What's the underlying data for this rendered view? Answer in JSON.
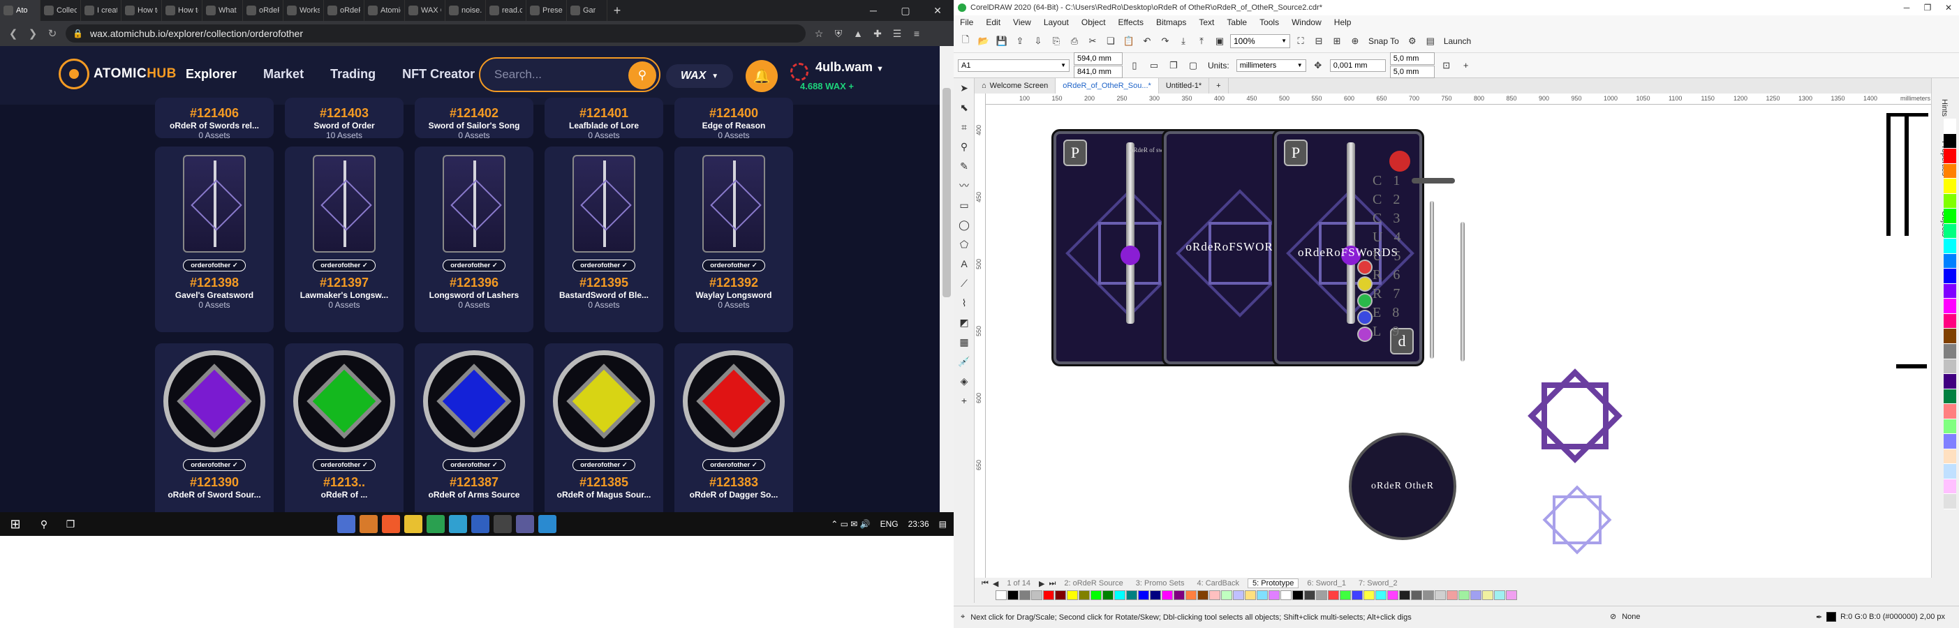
{
  "browser": {
    "tabs": [
      {
        "label": "Ato",
        "active": true
      },
      {
        "label": "Collecti"
      },
      {
        "label": "I create"
      },
      {
        "label": "How to"
      },
      {
        "label": "How to"
      },
      {
        "label": "What t"
      },
      {
        "label": "oRdeR"
      },
      {
        "label": "Works"
      },
      {
        "label": "oRdeR"
      },
      {
        "label": "Atomic"
      },
      {
        "label": "WAX C"
      },
      {
        "label": "noise.c"
      },
      {
        "label": "read.ca"
      },
      {
        "label": "Presean"
      },
      {
        "label": "Gar"
      }
    ],
    "url": "wax.atomichub.io/explorer/collection/orderofother"
  },
  "site": {
    "logo_text_a": "ATOMIC",
    "logo_text_b": "HUB",
    "nav": [
      "Explorer",
      "Market",
      "Trading",
      "NFT Creator"
    ],
    "search_placeholder": "Search...",
    "chain": "WAX",
    "account": "4ulb.wam",
    "balance": "4.688 WAX",
    "accent": "#f59b23"
  },
  "grid": {
    "row1": [
      {
        "num": "#121406",
        "name": "oRdeR of Swords rel...",
        "assets": "0 Assets"
      },
      {
        "num": "#121403",
        "name": "Sword of Order",
        "assets": "10 Assets"
      },
      {
        "num": "#121402",
        "name": "Sword of Sailor's Song",
        "assets": "0 Assets"
      },
      {
        "num": "#121401",
        "name": "Leafblade of Lore",
        "assets": "0 Assets"
      },
      {
        "num": "#121400",
        "name": "Edge of Reason",
        "assets": "0 Assets"
      }
    ],
    "row2": [
      {
        "chip": "orderofother ✓",
        "num": "#121398",
        "name": "Gavel's Greatsword",
        "assets": "0 Assets"
      },
      {
        "chip": "orderofother ✓",
        "num": "#121397",
        "name": "Lawmaker's Longsw...",
        "assets": "0 Assets"
      },
      {
        "chip": "orderofother ✓",
        "num": "#121396",
        "name": "Longsword of Lashers",
        "assets": "0 Assets"
      },
      {
        "chip": "orderofother ✓",
        "num": "#121395",
        "name": "BastardSword of Ble...",
        "assets": "0 Assets"
      },
      {
        "chip": "orderofother ✓",
        "num": "#121392",
        "name": "Waylay Longsword",
        "assets": "0 Assets"
      }
    ],
    "row3": [
      {
        "chip": "orderofother ✓",
        "num": "#121390",
        "name": "oRdeR of Sword Sour...",
        "gem": "#7a1bd0"
      },
      {
        "chip": "orderofother ✓",
        "num": "#1213..",
        "name": "oRdeR of ...",
        "gem": "#14b81e"
      },
      {
        "chip": "orderofother ✓",
        "num": "#121387",
        "name": "oRdeR of Arms Source",
        "gem": "#1422d8"
      },
      {
        "chip": "orderofother ✓",
        "num": "#121385",
        "name": "oRdeR of Magus Sour...",
        "gem": "#d8d414"
      },
      {
        "chip": "orderofother ✓",
        "num": "#121383",
        "name": "oRdeR of Dagger So...",
        "gem": "#e01414"
      }
    ]
  },
  "taskbar": {
    "lang": "ENG",
    "time": "23:36"
  },
  "corel": {
    "title": "CorelDRAW 2020 (64-Bit) - C:\\Users\\RedRo\\Desktop\\oRdeR of OtheR\\oRdeR_of_OtheR_Source2.cdr*",
    "menu": [
      "File",
      "Edit",
      "View",
      "Layout",
      "Object",
      "Effects",
      "Bitmaps",
      "Text",
      "Table",
      "Tools",
      "Window",
      "Help"
    ],
    "zoom": "100%",
    "snap": "Snap To",
    "launch": "Launch",
    "page_size": "A1",
    "width": "594,0 mm",
    "height": "841,0 mm",
    "units_label": "Units:",
    "units": "millimeters",
    "nudge": "0,001 mm",
    "dup_x": "5,0 mm",
    "dup_y": "5,0 mm",
    "doc_tabs": [
      "Welcome Screen",
      "oRdeR_of_OtheR_Sou...*",
      "Untitled-1*"
    ],
    "ruler_h": [
      "100",
      "150",
      "200",
      "250",
      "300",
      "350",
      "400",
      "450",
      "500",
      "550",
      "600",
      "650",
      "700",
      "750",
      "800",
      "850",
      "900",
      "950",
      "1000",
      "1050",
      "1100",
      "1150",
      "1200",
      "1250",
      "1300",
      "1350",
      "1400",
      "millimeters"
    ],
    "ruler_v": [
      "400",
      "450",
      "500",
      "550",
      "600",
      "650"
    ],
    "card_titles": [
      "oRdeRoFSWORDS",
      "oRdeRoFSWoRDS"
    ],
    "card_small_title": "oRdeR of swords",
    "card_badge_top": "P",
    "card_badge_bottom_1": "P",
    "card_badge_bottom_3": "d",
    "coin_text": "oRdeR OtheR",
    "codes": [
      [
        "C",
        "1"
      ],
      [
        "C",
        "2"
      ],
      [
        "C",
        "3"
      ],
      [
        "U",
        "4"
      ],
      [
        "U",
        "5"
      ],
      [
        "R",
        "6"
      ],
      [
        "R",
        "7"
      ],
      [
        "E",
        "8"
      ],
      [
        "L",
        "9"
      ]
    ],
    "dots": [
      "#e03a3a",
      "#e0d02a",
      "#2ab84a",
      "#3a4ae0",
      "#b040d0"
    ],
    "page_tabs": [
      "1 of 14",
      "2: oRdeR Source",
      "3: Promo Sets",
      "4: CardBack",
      "5: Prototype",
      "6: Sword_1",
      "7: Sword_2"
    ],
    "status_hint": "Next click for Drag/Scale; Second click for Rotate/Skew; Dbl-clicking tool selects all objects; Shift+click multi-selects; Alt+click digs",
    "fill": "None",
    "color_info": "R:0 G:0 B:0 (#000000)  2,00 px",
    "dockers": [
      "Hints",
      "Properties",
      "Objects"
    ],
    "palette": [
      "#ffffff",
      "#000000",
      "#ff0000",
      "#ff8000",
      "#ffff00",
      "#80ff00",
      "#00ff00",
      "#00ff80",
      "#00ffff",
      "#0080ff",
      "#0000ff",
      "#8000ff",
      "#ff00ff",
      "#ff0080",
      "#804000",
      "#808080",
      "#c0c0c0",
      "#400080",
      "#008040",
      "#ff8080",
      "#80ff80",
      "#8080ff",
      "#ffe0c0",
      "#c0e0ff",
      "#ffc0ff",
      "#e0e0e0"
    ],
    "colorbar": [
      "#ffffff",
      "#000000",
      "#808080",
      "#c0c0c0",
      "#ff0000",
      "#800000",
      "#ffff00",
      "#808000",
      "#00ff00",
      "#008000",
      "#00ffff",
      "#008080",
      "#0000ff",
      "#000080",
      "#ff00ff",
      "#800080",
      "#ff8040",
      "#804000",
      "#ffc0c0",
      "#c0ffc0",
      "#c0c0ff",
      "#ffe080",
      "#80e0ff",
      "#e080ff",
      "#ffffff",
      "#000000",
      "#404040",
      "#a0a0a0",
      "#ff4040",
      "#40ff40",
      "#4040ff",
      "#ffff40",
      "#40ffff",
      "#ff40ff",
      "#202020",
      "#606060",
      "#909090",
      "#d0d0d0",
      "#f0a0a0",
      "#a0f0a0",
      "#a0a0f0",
      "#f0f0a0",
      "#a0f0f0",
      "#f0a0f0"
    ]
  }
}
